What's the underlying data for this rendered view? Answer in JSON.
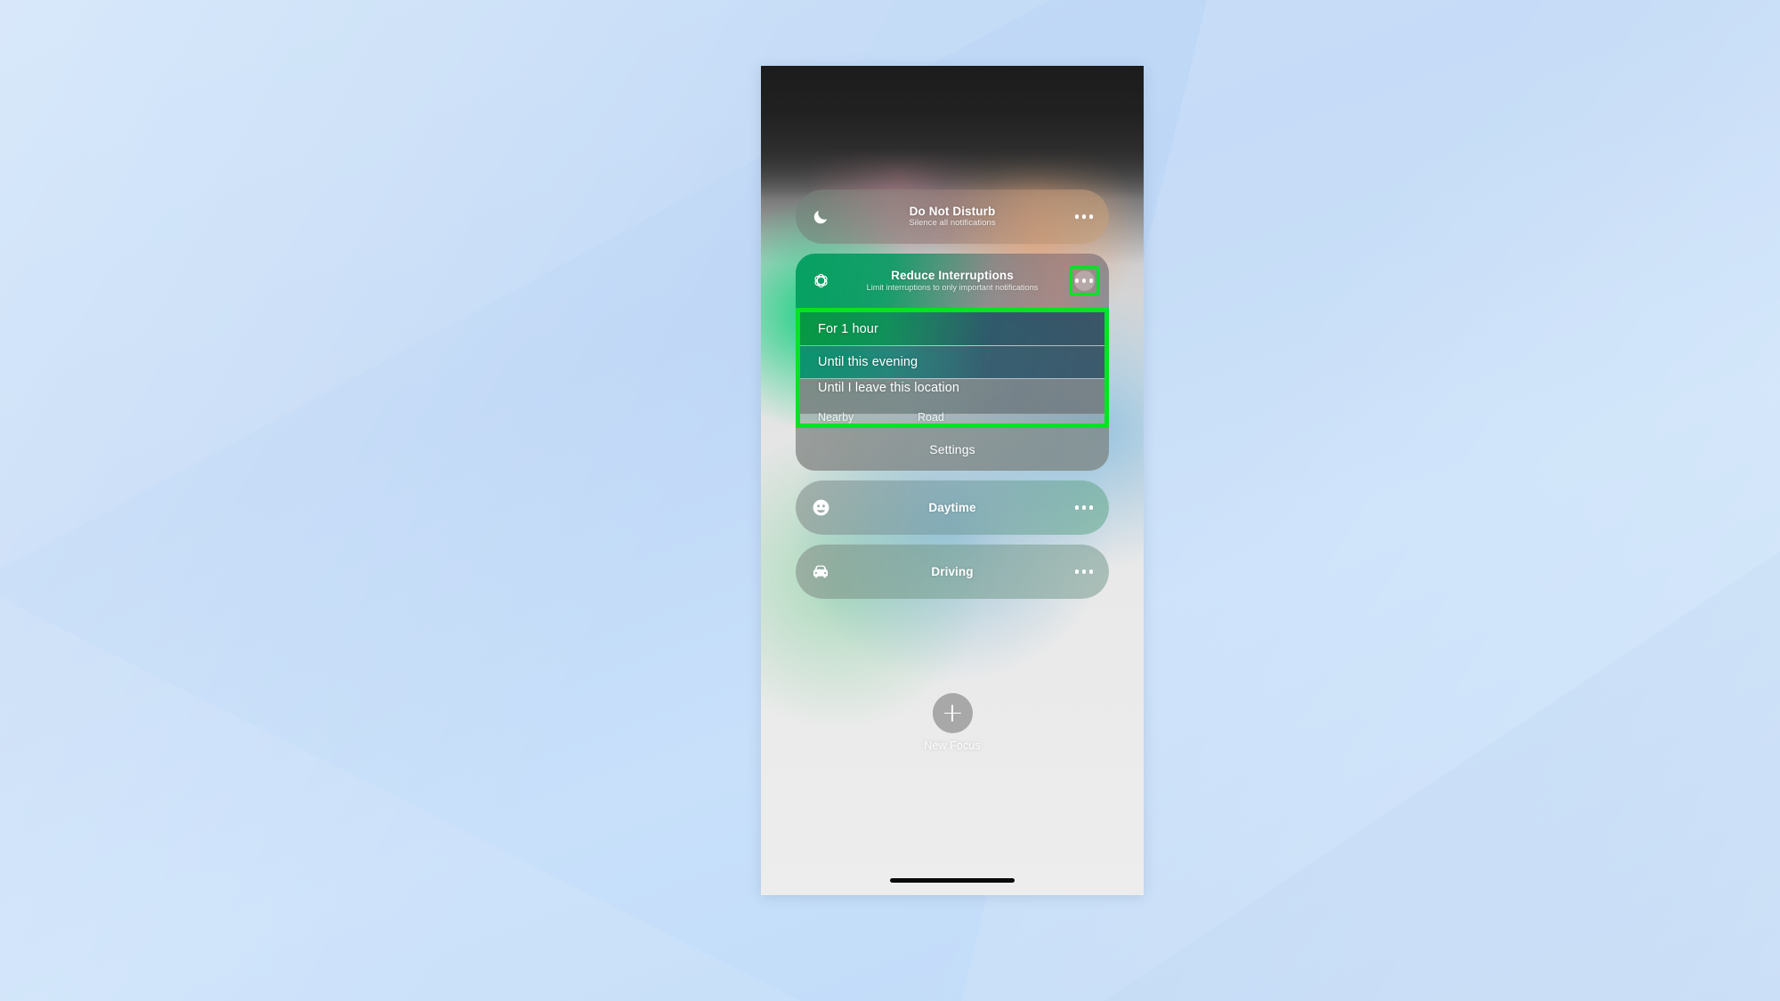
{
  "desktop": {
    "background_color": "#c3dcf8"
  },
  "phone": {
    "home_indicator": "home-indicator"
  },
  "highlight": {
    "color": "#06e224",
    "targets": [
      "reduce-interruptions-more-button",
      "reduce-interruptions-context-menu"
    ]
  },
  "focus_list": {
    "items": [
      {
        "id": "do-not-disturb",
        "icon": "moon-icon",
        "title": "Do Not Disturb",
        "subtitle": "Silence all notifications",
        "more_label": "more-options"
      },
      {
        "id": "reduce-interruptions",
        "icon": "reduce-interruptions-icon",
        "title": "Reduce Interruptions",
        "subtitle": "Limit interruptions to only important notifications",
        "more_label": "more-options",
        "expanded": true,
        "context_menu": {
          "items": [
            {
              "id": "for-1-hour",
              "label": "For 1 hour"
            },
            {
              "id": "until-this-evening",
              "label": "Until this evening"
            },
            {
              "id": "until-i-leave-this-location",
              "label": "Until I leave this location",
              "location_left": "Nearby",
              "location_right": "Road"
            }
          ]
        },
        "settings_label": "Settings"
      },
      {
        "id": "daytime",
        "icon": "smiley-face-icon",
        "title": "Daytime",
        "subtitle": "",
        "more_label": "more-options"
      },
      {
        "id": "driving",
        "icon": "car-icon",
        "title": "Driving",
        "subtitle": "",
        "more_label": "more-options"
      }
    ]
  },
  "new_focus": {
    "label": "New Focus",
    "icon": "plus-icon"
  }
}
